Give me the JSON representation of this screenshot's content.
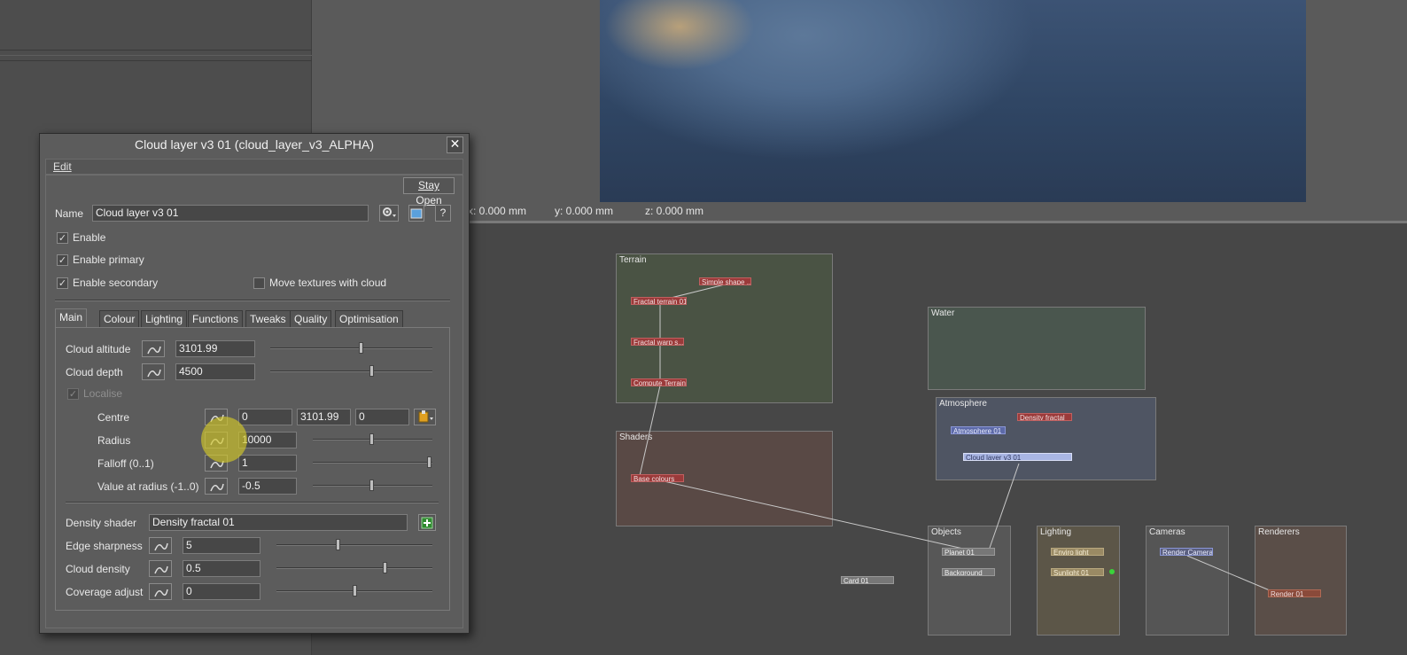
{
  "viewport": {
    "coords": {
      "x": "x: 0.000 mm",
      "y": "y: 0.000 mm",
      "z": "z: 0.000 mm"
    }
  },
  "node_graph": {
    "groups": {
      "terrain": "Terrain",
      "water": "Water",
      "atmosphere": "Atmosphere",
      "shaders": "Shaders",
      "objects": "Objects",
      "lighting": "Lighting",
      "cameras": "Cameras",
      "renderers": "Renderers"
    },
    "nodes": {
      "simple_shape": "Simple shape ...",
      "fractal_terrain": "Fractal terrain 01",
      "fractal_warp": "Fractal warp s...",
      "compute_terrain": "Compute Terrain",
      "base_colours": "Base colours",
      "atmosphere": "Atmosphere 01",
      "density_fractal": "Density fractal",
      "cloud_layer": "Cloud layer v3 01",
      "planet": "Planet 01",
      "background": "Background",
      "card": "Card 01",
      "enviro_light": "Enviro light",
      "sunlight": "Sunlight 01",
      "render_camera": "Render Camera",
      "render": "Render 01"
    },
    "colors": {
      "terrain_bg": "#4a5344",
      "water_bg": "#4a564e",
      "atmosphere_bg": "#4f5563",
      "shaders_bg": "#594945",
      "objects_bg": "#575757",
      "lighting_bg": "#5c5648",
      "cameras_bg": "#555555",
      "renderers_bg": "#5a4e48"
    }
  },
  "dialog": {
    "title": "Cloud layer v3 01    (cloud_layer_v3_ALPHA)",
    "close_label": "✕",
    "menu": {
      "edit": "Edit"
    },
    "stay_open": "Stay Open",
    "name_label": "Name",
    "name_value": "Cloud layer v3 01",
    "checks": {
      "enable": "Enable",
      "enable_primary": "Enable primary",
      "enable_secondary": "Enable secondary",
      "move_textures": "Move textures with cloud",
      "localise": "Localise"
    },
    "tabs": [
      "Main",
      "Colour",
      "Lighting",
      "Functions",
      "Tweaks",
      "Quality",
      "Optimisation"
    ],
    "main": {
      "cloud_altitude": {
        "label": "Cloud altitude",
        "value": "3101.99",
        "slider": 0.56
      },
      "cloud_depth": {
        "label": "Cloud depth",
        "value": "4500",
        "slider": 0.62
      },
      "centre": {
        "label": "Centre",
        "x": "0",
        "y": "3101.99",
        "z": "0"
      },
      "radius": {
        "label": "Radius",
        "value": "10000",
        "slider": 0.5
      },
      "falloff": {
        "label": "Falloff (0..1)",
        "value": "1",
        "slider": 1.0
      },
      "value_at_radius": {
        "label": "Value at radius (-1..0)",
        "value": "-0.5",
        "slider": 0.5
      },
      "density_shader": {
        "label": "Density shader",
        "value": "Density fractal 01"
      },
      "edge_sharpness": {
        "label": "Edge sharpness",
        "value": "5",
        "slider": 0.4
      },
      "cloud_density": {
        "label": "Cloud density",
        "value": "0.5",
        "slider": 0.7
      },
      "coverage_adjust": {
        "label": "Coverage adjust",
        "value": "0",
        "slider": 0.5
      }
    }
  }
}
